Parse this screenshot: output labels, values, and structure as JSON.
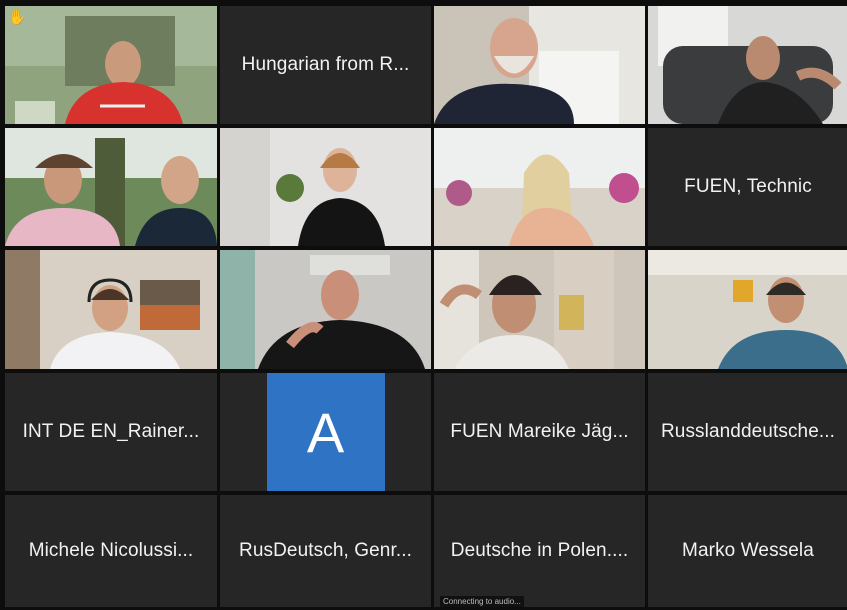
{
  "meeting": {
    "tiles": [
      {
        "type": "video",
        "scene": "man-red-jacket",
        "hand_raised": true
      },
      {
        "type": "name",
        "label": "Hungarian from R..."
      },
      {
        "type": "video",
        "scene": "older-man-sdu-shirt"
      },
      {
        "type": "video",
        "scene": "man-armchair"
      },
      {
        "type": "video",
        "scene": "two-men-outdoors"
      },
      {
        "type": "video",
        "scene": "woman-black-top"
      },
      {
        "type": "video",
        "scene": "woman-window-flowers"
      },
      {
        "type": "name",
        "label": "FUEN, Technic"
      },
      {
        "type": "video",
        "scene": "man-headset"
      },
      {
        "type": "video",
        "scene": "speaker-black-shirt",
        "active": true
      },
      {
        "type": "video",
        "scene": "man-hand-on-head"
      },
      {
        "type": "video",
        "scene": "man-blue-shirt"
      },
      {
        "type": "name",
        "label": "INT DE EN_Rainer..."
      },
      {
        "type": "avatar",
        "initial": "A"
      },
      {
        "type": "name",
        "label": "FUEN Mareike Jäg..."
      },
      {
        "type": "name",
        "label": "Russlanddeutsche..."
      },
      {
        "type": "name",
        "label": "Michele Nicolussi..."
      },
      {
        "type": "name",
        "label": "RusDeutsch, Genr..."
      },
      {
        "type": "name",
        "label": "Deutsche in Polen...."
      },
      {
        "type": "name",
        "label": "Marko Wessela"
      }
    ],
    "connecting_status": "Connecting to audio...",
    "colors": {
      "active_speaker": "#b9cf6b",
      "avatar_bg": "#2f73c4",
      "tile_bg": "#262626"
    }
  }
}
